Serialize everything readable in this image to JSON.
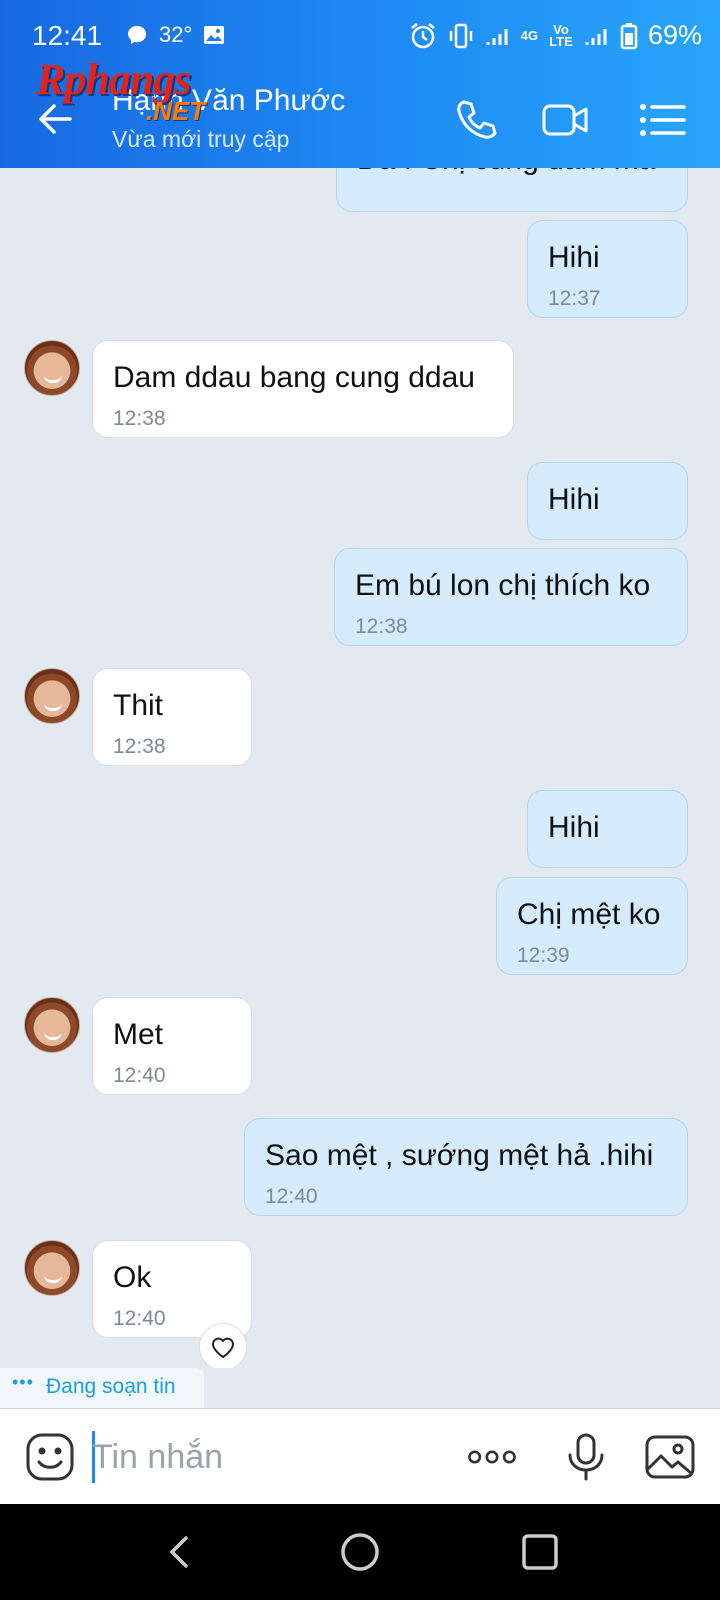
{
  "status_bar": {
    "time": "12:41",
    "temp": "32°",
    "network_4g": "4G",
    "volte": "Vo LTE",
    "battery": "69%"
  },
  "header": {
    "watermark_main": "Rphangs",
    "watermark_sub": ".NET",
    "contact_name": "Hạnh Văn Phước",
    "contact_status": "Vừa mới truy cập"
  },
  "messages": [
    {
      "dir": "out",
      "text": "Da . Chị cung dam ma",
      "time": ""
    },
    {
      "dir": "out",
      "text": "Hihi",
      "time": "12:37"
    },
    {
      "dir": "in",
      "text": "Dam ddau bang cung ddau",
      "time": "12:38"
    },
    {
      "dir": "out",
      "text": "Hihi",
      "time": ""
    },
    {
      "dir": "out",
      "text": "Em bú lon chị thích ko",
      "time": "12:38"
    },
    {
      "dir": "in",
      "text": "Thit",
      "time": "12:38"
    },
    {
      "dir": "out",
      "text": "Hihi",
      "time": ""
    },
    {
      "dir": "out",
      "text": "Chị mệt ko",
      "time": "12:39"
    },
    {
      "dir": "in",
      "text": "Met",
      "time": "12:40"
    },
    {
      "dir": "out",
      "text": "Sao mệt , sướng mệt hả .hihi",
      "time": "12:40"
    },
    {
      "dir": "in",
      "text": "Ok",
      "time": "12:40"
    }
  ],
  "typing_indicator": "Đang soạn tin",
  "composer": {
    "placeholder": "Tin nhắn"
  },
  "colors": {
    "header_start": "#1769e0",
    "header_end": "#28a6fb",
    "outgoing_bubble": "#d4ecfd",
    "incoming_bubble": "#ffffff",
    "chat_bg": "#e2e9f1",
    "typing_text": "#1aa0d8"
  }
}
